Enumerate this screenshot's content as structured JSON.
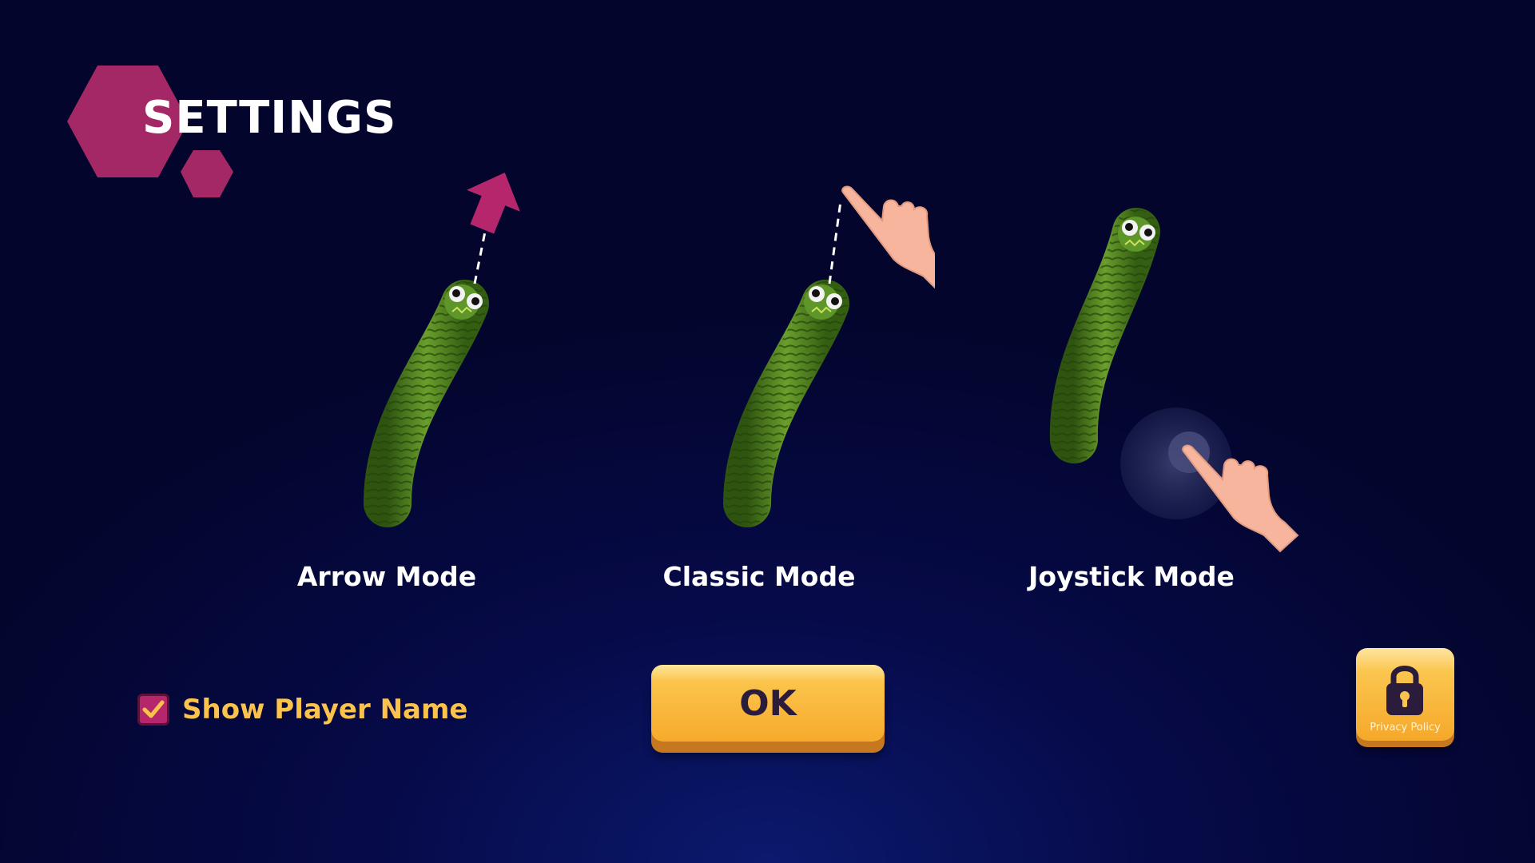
{
  "header": {
    "title": "SETTINGS"
  },
  "modes": [
    {
      "label": "Arrow Mode",
      "icon": "arrow-icon"
    },
    {
      "label": "Classic Mode",
      "icon": "pointing-hand-icon"
    },
    {
      "label": "Joystick Mode",
      "icon": "joystick-icon"
    }
  ],
  "options": {
    "show_player_name": {
      "label": "Show Player Name",
      "checked": true
    }
  },
  "buttons": {
    "ok_label": "OK",
    "privacy_label": "Privacy Policy",
    "privacy_icon": "lock-icon"
  },
  "colors": {
    "background": "#060a48",
    "accent_magenta": "#b5266d",
    "button_gold": "#f7aa2c",
    "label_gold": "#fbc24c",
    "worm_green": "#4e7d1f"
  }
}
